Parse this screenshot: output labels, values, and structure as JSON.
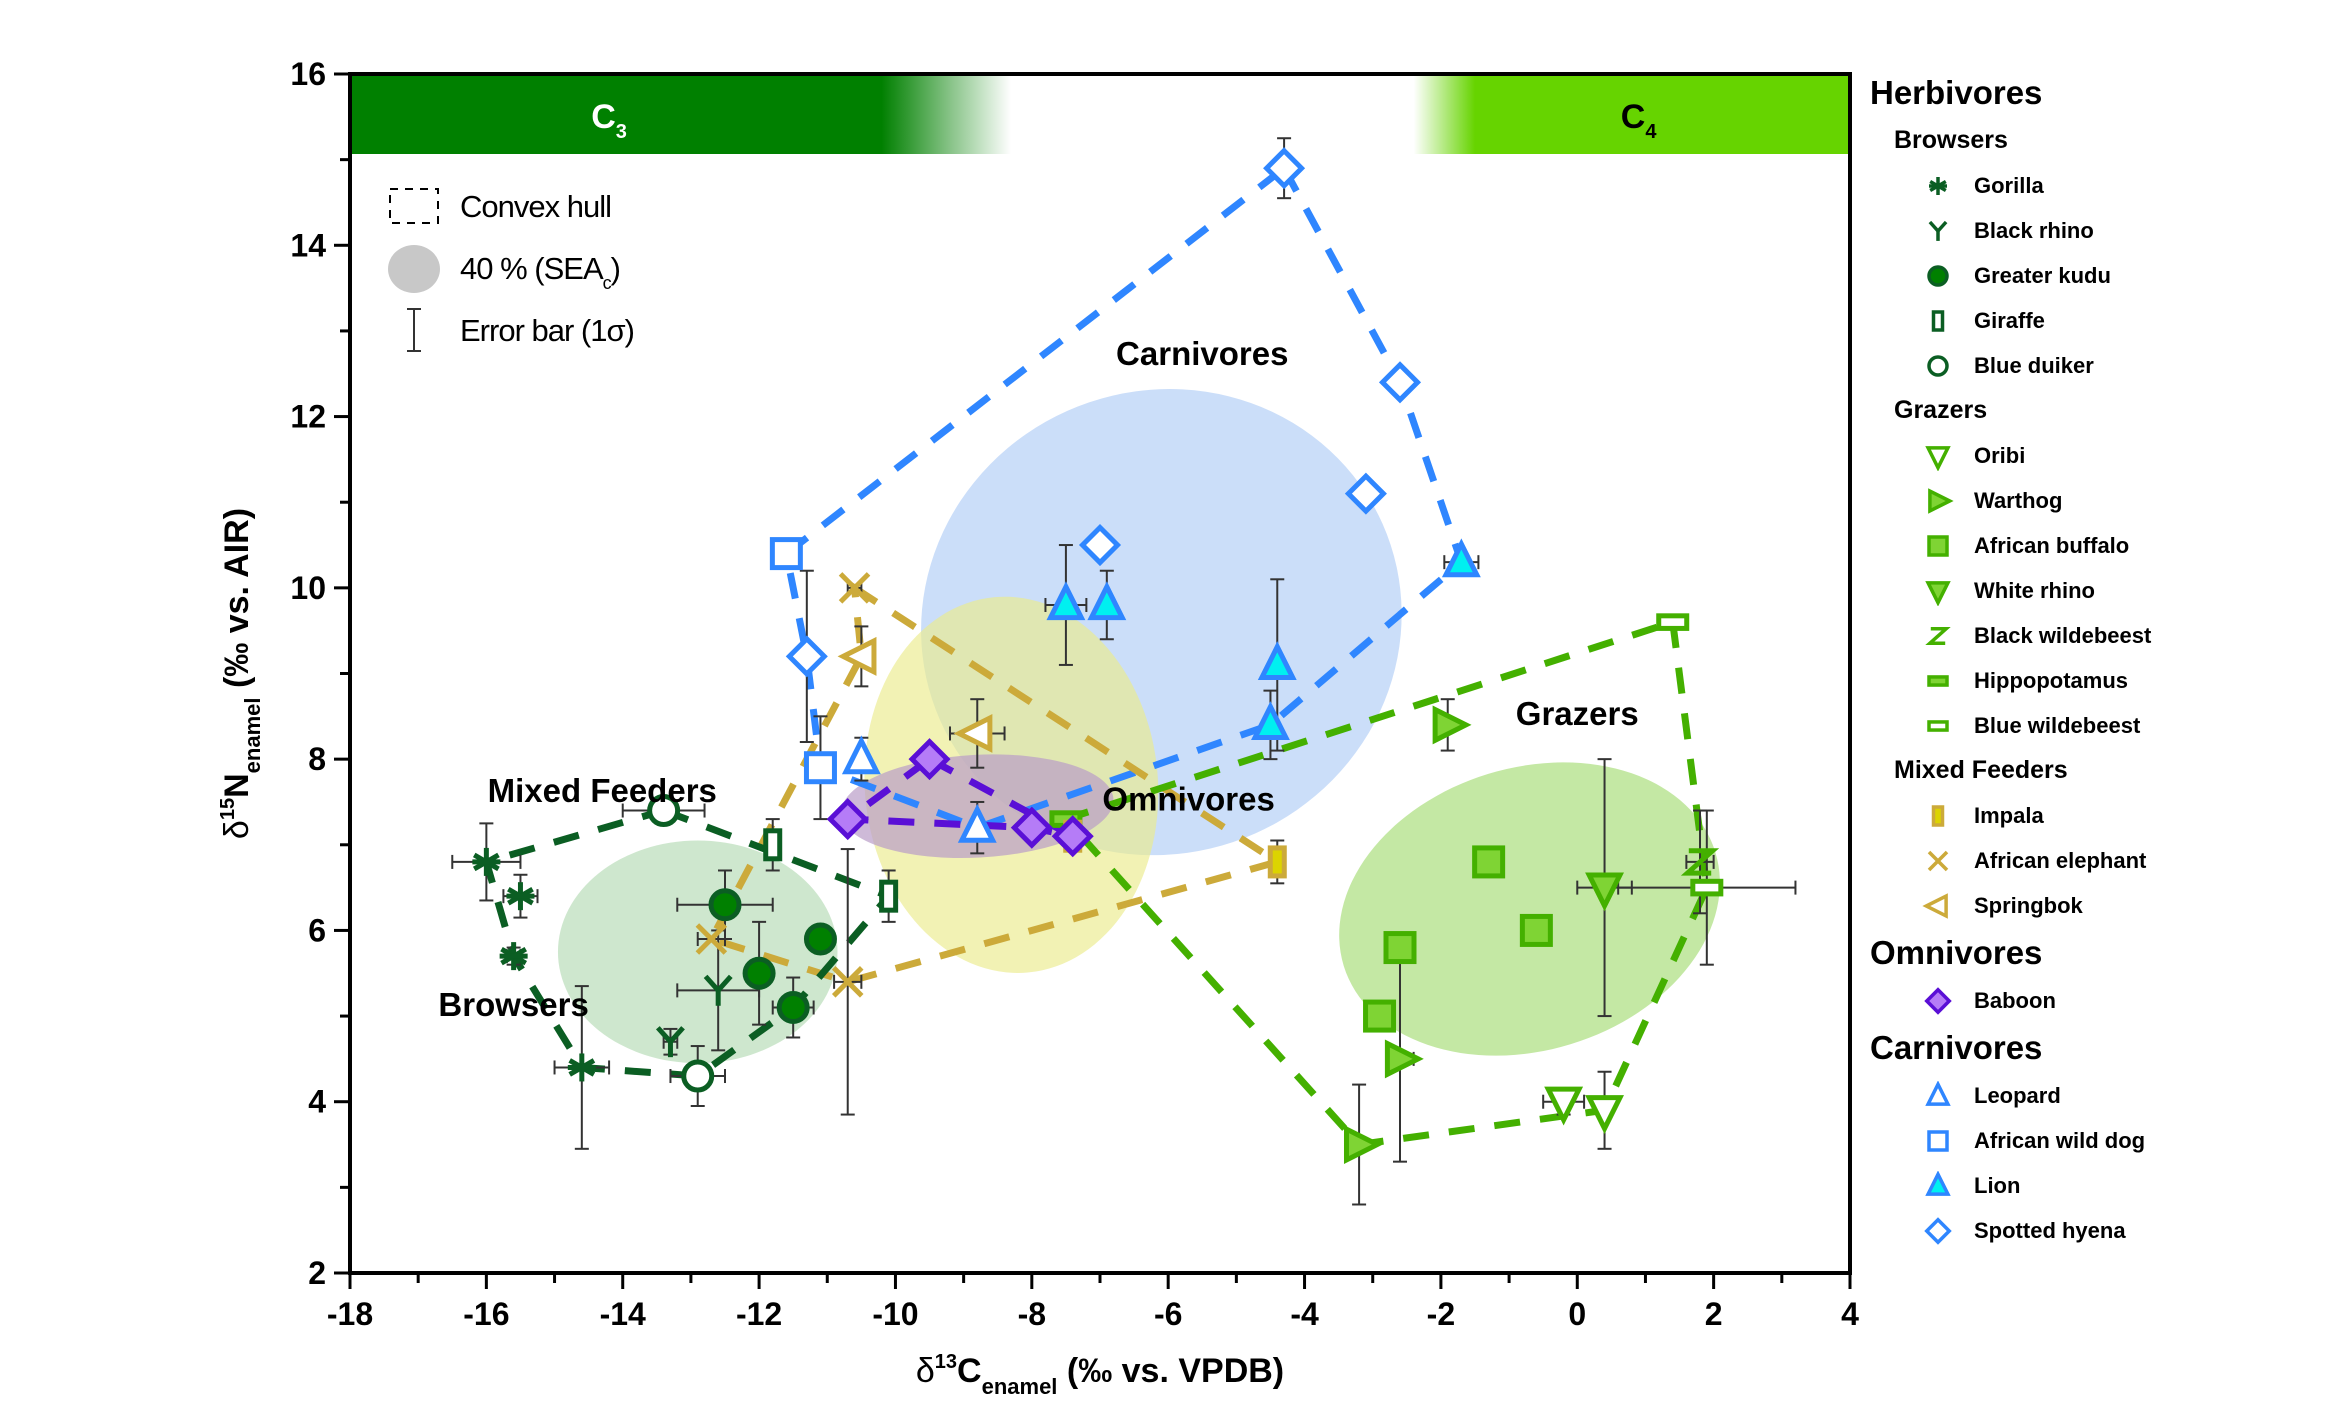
{
  "chart_data": {
    "type": "scatter",
    "xlabel": "δ13C enamel (‰ vs. VPDB)",
    "xlabel_parts": {
      "delta": "δ",
      "sup": "13",
      "main": "C",
      "sub": "enamel",
      "rest": " (‰ vs. VPDB)"
    },
    "ylabel": "δ15N enamel (‰ vs. AIR)",
    "ylabel_parts": {
      "delta": "δ",
      "sup": "15",
      "main": "N",
      "sub": "enamel",
      "rest": " (‰ vs. AIR)"
    },
    "xlim": [
      -18,
      4
    ],
    "ylim": [
      2,
      16
    ],
    "xticks": [
      -18,
      -16,
      -14,
      -12,
      -10,
      -8,
      -6,
      -4,
      -2,
      0,
      2,
      4
    ],
    "yticks": [
      2,
      4,
      6,
      8,
      10,
      12,
      14,
      16
    ],
    "grid": false,
    "bands": [
      {
        "label": "C",
        "sub": "3",
        "color": "#008000",
        "from": -18,
        "solid_to": -10.2,
        "fade_to": -8.3
      },
      {
        "label": "C",
        "sub": "4",
        "color": "#66d400",
        "from": 4,
        "solid_to": -1.5,
        "fade_to": -2.4
      }
    ],
    "inset_legend": [
      {
        "symbol": "dashed-box",
        "label": "Convex hull"
      },
      {
        "symbol": "grey-ellipse",
        "label": "40 % (SEA",
        "sub": "c",
        "tail": ")"
      },
      {
        "symbol": "error-bar",
        "label": "Error bar (1σ)"
      }
    ],
    "group_labels": [
      {
        "text": "Carnivores",
        "x": -5.5,
        "y": 12.6
      },
      {
        "text": "Mixed Feeders",
        "x": -14.3,
        "y": 7.5
      },
      {
        "text": "Omnivores",
        "x": -5.7,
        "y": 7.4
      },
      {
        "text": "Grazers",
        "x": 0,
        "y": 8.4
      },
      {
        "text": "Browsers",
        "x": -15.6,
        "y": 5.0
      }
    ],
    "ellipses": [
      {
        "group": "Carnivores",
        "cx": -6.1,
        "cy": 9.6,
        "rx": 7.1,
        "ry": 2.7,
        "angle": 24,
        "color": "#a9c8f5",
        "opacity": 0.6
      },
      {
        "group": "Mixed Feeders",
        "cx": -8.3,
        "cy": 7.7,
        "rx": 4.3,
        "ry": 2.2,
        "angle": 5,
        "color": "#ebeb8c",
        "opacity": 0.65
      },
      {
        "group": "Omnivores",
        "cx": -8.8,
        "cy": 7.45,
        "rx": 4.0,
        "ry": 0.6,
        "angle": 3,
        "color": "#b99cc8",
        "opacity": 0.7
      },
      {
        "group": "Browsers",
        "cx": -12.9,
        "cy": 5.75,
        "rx": 4.1,
        "ry": 1.3,
        "angle": 0,
        "color": "#a6d4a6",
        "opacity": 0.55
      },
      {
        "group": "Grazers",
        "cx": -0.7,
        "cy": 6.25,
        "rx": 5.7,
        "ry": 1.65,
        "angle": 17,
        "color": "#93d65a",
        "opacity": 0.55
      }
    ],
    "hulls": [
      {
        "group": "Carnivores",
        "color": "#2f86ff",
        "points": [
          [
            -4.3,
            14.9
          ],
          [
            -2.6,
            12.4
          ],
          [
            -1.7,
            10.3
          ],
          [
            -4.5,
            8.4
          ],
          [
            -8.8,
            7.2
          ],
          [
            -11.1,
            7.9
          ],
          [
            -11.3,
            9.2
          ],
          [
            -11.6,
            10.4
          ]
        ]
      },
      {
        "group": "Mixed Feeders",
        "color": "#ccaa3a",
        "points": [
          [
            -10.6,
            10.0
          ],
          [
            -4.4,
            6.8
          ],
          [
            -10.7,
            5.4
          ],
          [
            -12.7,
            5.9
          ],
          [
            -10.5,
            9.2
          ]
        ]
      },
      {
        "group": "Omnivores",
        "color": "#5a0fd6",
        "points": [
          [
            -9.5,
            8.0
          ],
          [
            -7.4,
            7.1
          ],
          [
            -8.0,
            7.2
          ],
          [
            -10.7,
            7.3
          ]
        ]
      },
      {
        "group": "Browsers",
        "color": "#0b5e23",
        "points": [
          [
            -13.4,
            7.4
          ],
          [
            -10.1,
            6.4
          ],
          [
            -11.5,
            5.1
          ],
          [
            -12.9,
            4.3
          ],
          [
            -14.6,
            4.4
          ],
          [
            -15.6,
            5.7
          ],
          [
            -16.0,
            6.8
          ]
        ]
      },
      {
        "group": "Grazers",
        "color": "#44b000",
        "points": [
          [
            1.4,
            9.6
          ],
          [
            1.9,
            6.5
          ],
          [
            0.4,
            3.9
          ],
          [
            -3.2,
            3.5
          ],
          [
            -7.5,
            7.3
          ]
        ]
      }
    ],
    "series": [
      {
        "name": "Gorilla",
        "group": "Browsers",
        "marker": "asterisk",
        "stroke": "#0b5e23",
        "fill": "none",
        "points": [
          {
            "x": -16.0,
            "y": 6.8,
            "ex": 0.5,
            "ey": 0.45
          },
          {
            "x": -15.5,
            "y": 6.4,
            "ex": 0.25,
            "ey": 0.25
          },
          {
            "x": -15.6,
            "y": 5.7,
            "ex": 0.1,
            "ey": 0.1
          },
          {
            "x": -14.6,
            "y": 4.4,
            "ex": 0.4,
            "ey": 0.95
          }
        ]
      },
      {
        "name": "Black rhino",
        "group": "Browsers",
        "marker": "y",
        "stroke": "#0b5e23",
        "fill": "none",
        "points": [
          {
            "x": -12.6,
            "y": 5.3,
            "ex": 0.6,
            "ey": 0.7
          },
          {
            "x": -13.3,
            "y": 4.7,
            "ex": 0.1,
            "ey": 0.15
          }
        ]
      },
      {
        "name": "Greater kudu",
        "group": "Browsers",
        "marker": "circle",
        "stroke": "#0b5e23",
        "fill": "#008000",
        "points": [
          {
            "x": -12.5,
            "y": 6.3,
            "ex": 0.7,
            "ey": 0.4
          },
          {
            "x": -11.1,
            "y": 5.9,
            "ex": 0,
            "ey": 0
          },
          {
            "x": -12.0,
            "y": 5.5,
            "ex": 0,
            "ey": 0.6
          },
          {
            "x": -11.5,
            "y": 5.1,
            "ex": 0.3,
            "ey": 0.35
          }
        ]
      },
      {
        "name": "Giraffe",
        "group": "Browsers",
        "marker": "tall-rect",
        "stroke": "#0b5e23",
        "fill": "#ffffff",
        "points": [
          {
            "x": -11.8,
            "y": 7.0,
            "ex": 0.1,
            "ey": 0.3
          },
          {
            "x": -10.1,
            "y": 6.4,
            "ex": 0,
            "ey": 0.3
          }
        ]
      },
      {
        "name": "Blue duiker",
        "group": "Browsers",
        "marker": "circle",
        "stroke": "#0b5e23",
        "fill": "#ffffff",
        "points": [
          {
            "x": -13.4,
            "y": 7.4,
            "ex": 0.6,
            "ey": 0
          },
          {
            "x": -12.9,
            "y": 4.3,
            "ex": 0.4,
            "ey": 0.35
          }
        ]
      },
      {
        "name": "Oribi",
        "group": "Grazers",
        "marker": "tri-down",
        "stroke": "#44b000",
        "fill": "#ffffff",
        "points": [
          {
            "x": -0.2,
            "y": 4.0,
            "ex": 0.3,
            "ey": 0.15
          },
          {
            "x": 0.4,
            "y": 3.9,
            "ex": 0,
            "ey": 0.45
          }
        ]
      },
      {
        "name": "Warthog",
        "group": "Grazers",
        "marker": "tri-right",
        "stroke": "#44b000",
        "fill": "#7fd434",
        "points": [
          {
            "x": -1.9,
            "y": 8.4,
            "ex": 0,
            "ey": 0.3
          },
          {
            "x": -2.6,
            "y": 4.5,
            "ex": 0.2,
            "ey": 1.2
          },
          {
            "x": -3.2,
            "y": 3.5,
            "ex": 0,
            "ey": 0.7
          }
        ]
      },
      {
        "name": "African buffalo",
        "group": "Grazers",
        "marker": "square",
        "stroke": "#44b000",
        "fill": "#7fd434",
        "points": [
          {
            "x": -1.3,
            "y": 6.8,
            "ex": 0,
            "ey": 0
          },
          {
            "x": -0.6,
            "y": 6.0,
            "ex": 0,
            "ey": 0
          },
          {
            "x": -2.6,
            "y": 5.8,
            "ex": 0,
            "ey": 0
          },
          {
            "x": -2.9,
            "y": 5.0,
            "ex": 0,
            "ey": 0
          }
        ]
      },
      {
        "name": "White rhino",
        "group": "Grazers",
        "marker": "tri-down",
        "stroke": "#44b000",
        "fill": "#7fd434",
        "points": [
          {
            "x": 0.4,
            "y": 6.5,
            "ex": 0.4,
            "ey": 1.5
          }
        ]
      },
      {
        "name": "Black wildebeest",
        "group": "Grazers",
        "marker": "z",
        "stroke": "#44b000",
        "fill": "none",
        "points": [
          {
            "x": 1.8,
            "y": 6.8,
            "ex": 0.2,
            "ey": 0.6
          }
        ]
      },
      {
        "name": "Hippopotamus",
        "group": "Grazers",
        "marker": "wide-rect",
        "stroke": "#44b000",
        "fill": "#7fd434",
        "points": [
          {
            "x": -7.5,
            "y": 7.3,
            "ex": 0,
            "ey": 0
          }
        ]
      },
      {
        "name": "Blue wildebeest",
        "group": "Grazers",
        "marker": "wide-rect",
        "stroke": "#44b000",
        "fill": "#ffffff",
        "points": [
          {
            "x": 1.4,
            "y": 9.6,
            "ex": 0,
            "ey": 0
          },
          {
            "x": 1.9,
            "y": 6.5,
            "ex": 1.3,
            "ey": 0.9
          }
        ]
      },
      {
        "name": "Impala",
        "group": "Mixed Feeders",
        "marker": "tall-rect",
        "stroke": "#ccaa3a",
        "fill": "#dcd400",
        "points": [
          {
            "x": -7.4,
            "y": 7.1,
            "ex": 0,
            "ey": 0.15
          },
          {
            "x": -4.4,
            "y": 6.8,
            "ex": 0.1,
            "ey": 0.25
          }
        ]
      },
      {
        "name": "African elephant",
        "group": "Mixed Feeders",
        "marker": "x",
        "stroke": "#ccaa3a",
        "fill": "none",
        "points": [
          {
            "x": -10.6,
            "y": 10.0,
            "ex": 0.1,
            "ey": 0
          },
          {
            "x": -12.7,
            "y": 5.9,
            "ex": 0.2,
            "ey": 0
          },
          {
            "x": -10.7,
            "y": 5.4,
            "ex": 0.2,
            "ey": 1.55
          }
        ]
      },
      {
        "name": "Springbok",
        "group": "Mixed Feeders",
        "marker": "tri-left",
        "stroke": "#ccaa3a",
        "fill": "#ffffff",
        "points": [
          {
            "x": -10.5,
            "y": 9.2,
            "ex": 0,
            "ey": 0.35
          },
          {
            "x": -8.8,
            "y": 8.3,
            "ex": 0.4,
            "ey": 0.4
          }
        ]
      },
      {
        "name": "Baboon",
        "group": "Omnivores",
        "marker": "diamond",
        "stroke": "#5a0fd6",
        "fill": "#b57cf7",
        "points": [
          {
            "x": -10.7,
            "y": 7.3,
            "ex": 0,
            "ey": 0
          },
          {
            "x": -9.5,
            "y": 8.0,
            "ex": 0,
            "ey": 0
          },
          {
            "x": -8.0,
            "y": 7.2,
            "ex": 0,
            "ey": 0
          },
          {
            "x": -7.4,
            "y": 7.1,
            "ex": 0,
            "ey": 0
          }
        ]
      },
      {
        "name": "Leopard",
        "group": "Carnivores",
        "marker": "tri-up",
        "stroke": "#2f86ff",
        "fill": "#ffffff",
        "points": [
          {
            "x": -10.5,
            "y": 8.0,
            "ex": 0,
            "ey": 0.25
          },
          {
            "x": -8.8,
            "y": 7.2,
            "ex": 0.1,
            "ey": 0.3
          }
        ]
      },
      {
        "name": "African wild dog",
        "group": "Carnivores",
        "marker": "square",
        "stroke": "#2f86ff",
        "fill": "#ffffff",
        "points": [
          {
            "x": -11.6,
            "y": 10.4,
            "ex": 0.1,
            "ey": 0.1
          },
          {
            "x": -11.1,
            "y": 7.9,
            "ex": 0,
            "ey": 0.6
          }
        ]
      },
      {
        "name": "Lion",
        "group": "Carnivores",
        "marker": "tri-up",
        "stroke": "#2f86ff",
        "fill": "#00f0f0",
        "points": [
          {
            "x": -7.5,
            "y": 9.8,
            "ex": 0.3,
            "ey": 0.7
          },
          {
            "x": -6.9,
            "y": 9.8,
            "ex": 0,
            "ey": 0.4
          },
          {
            "x": -4.4,
            "y": 9.1,
            "ex": 0,
            "ey": 1.0
          },
          {
            "x": -4.5,
            "y": 8.4,
            "ex": 0,
            "ey": 0.4
          },
          {
            "x": -1.7,
            "y": 10.3,
            "ex": 0.25,
            "ey": 0
          }
        ]
      },
      {
        "name": "Spotted hyena",
        "group": "Carnivores",
        "marker": "diamond",
        "stroke": "#2f86ff",
        "fill": "#ffffff",
        "points": [
          {
            "x": -11.3,
            "y": 9.2,
            "ex": 0,
            "ey": 1.0
          },
          {
            "x": -7.0,
            "y": 10.5,
            "ex": 0,
            "ey": 0
          },
          {
            "x": -4.3,
            "y": 14.9,
            "ex": 0,
            "ey": 0.35
          },
          {
            "x": -2.6,
            "y": 12.4,
            "ex": 0,
            "ey": 0
          },
          {
            "x": -3.1,
            "y": 11.1,
            "ex": 0,
            "ey": 0
          }
        ]
      }
    ],
    "legend": {
      "placement": "right",
      "sections": [
        {
          "title": "Herbivores",
          "subsections": [
            {
              "title": "Browsers",
              "items": [
                "Gorilla",
                "Black rhino",
                "Greater kudu",
                "Giraffe",
                "Blue duiker"
              ]
            },
            {
              "title": "Grazers",
              "items": [
                "Oribi",
                "Warthog",
                "African buffalo",
                "White rhino",
                "Black wildebeest",
                "Hippopotamus",
                "Blue wildebeest"
              ]
            },
            {
              "title": "Mixed Feeders",
              "items": [
                "Impala",
                "African elephant",
                "Springbok"
              ]
            }
          ]
        },
        {
          "title": "Omnivores",
          "subsections": [
            {
              "title": "",
              "items": [
                "Baboon"
              ]
            }
          ]
        },
        {
          "title": "Carnivores",
          "subsections": [
            {
              "title": "",
              "items": [
                "Leopard",
                "African wild dog",
                "Lion",
                "Spotted hyena"
              ]
            }
          ]
        }
      ]
    }
  }
}
